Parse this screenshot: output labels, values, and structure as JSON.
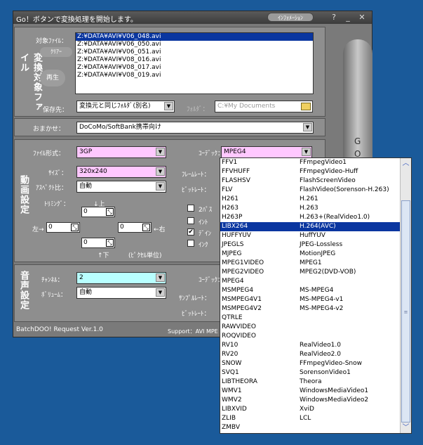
{
  "window": {
    "title": "Go！ボタンで変換処理を開始します。",
    "info_button": "ｲﾝﾌｫﾒｰｼｮﾝ",
    "help_icon": "?",
    "min_icon": "_",
    "close_icon": "✕"
  },
  "source": {
    "section_title": "変換対象ファイル",
    "files_label": "対象ﾌｧｲﾙ：",
    "clear_button": "ｸﾘｱｰ",
    "play_button": "再生",
    "files": [
      "Z:¥DATA¥AVI¥V06_048.avi",
      "Z:¥DATA¥AVI¥V06_050.avi",
      "Z:¥DATA¥AVI¥V06_051.avi",
      "Z:¥DATA¥AVI¥V08_016.avi",
      "Z:¥DATA¥AVI¥V08_017.avi",
      "Z:¥DATA¥AVI¥V08_019.avi"
    ],
    "save_label": "保存先：",
    "save_value": "変換元と同じﾌｫﾙﾀﾞ(別名)",
    "folder_label": "ﾌｫﾙﾀﾞ：",
    "folder_value": "C:¥My Documents"
  },
  "preset": {
    "label": "おまかせ：",
    "value": "DoCoMo/SoftBank携帯向け"
  },
  "video": {
    "section_title": "動画設定",
    "format_label": "ﾌｧｲﾙ形式：",
    "format_value": "3GP",
    "size_label": "ｻｲｽﾞ：",
    "size_value": "320x240",
    "aspect_label": "ｱｽﾍﾟｸﾄ比：",
    "aspect_value": "自動",
    "trim_label": "ﾄﾘﾐﾝｸﾞ：",
    "trim_top_label": "↓上",
    "trim_left_label": "左→",
    "trim_right_label": "←右",
    "trim_bottom_label": "↑下",
    "trim_top": "0",
    "trim_left": "0",
    "trim_right": "0",
    "trim_bottom": "0",
    "pixel_unit": "(ﾋﾟｸｾﾙ単位)",
    "codec_label": "ｺｰﾃﾞｯｸ：",
    "codec_value": "MPEG4",
    "framerate_label": "ﾌﾚｰﾑﾚｰﾄ：",
    "bitrate_label": "ﾋﾞｯﾄﾚｰﾄ：",
    "opt1": "2ﾊﾟｽ",
    "opt2": "ｲﾝﾄ",
    "opt3": "ﾃﾞｲﾝ",
    "opt4": "ｲﾝｸ"
  },
  "audio": {
    "section_title": "音声設定",
    "channel_label": "ﾁｬﾝﾈﾙ：",
    "channel_value": "2",
    "volume_label": "ﾎﾞﾘｭｰﾑ：",
    "volume_value": "自動",
    "codec_label": "ｺｰﾃﾞｯｸ：",
    "samplerate_label": "ｻﾝﾌﾟﾙﾚｰﾄ：",
    "bitrate_label": "ﾋﾞｯﾄﾚｰﾄ："
  },
  "footer": {
    "version": "BatchDOO! Request Ver.1.0",
    "support": "Support：AVI MPE"
  },
  "go_button": {
    "label1": "G",
    "label2": "O"
  },
  "codec_dropdown": {
    "highlighted_index": 7,
    "items": [
      [
        "FFV1",
        "FFmpegVideo1"
      ],
      [
        "FFVHUFF",
        "FFmpegVideo-Huff"
      ],
      [
        "FLASHSV",
        "FlashScreenVideo"
      ],
      [
        "FLV",
        "FlashVideo(Sorenson-H.263)"
      ],
      [
        "H261",
        "H.261"
      ],
      [
        "H263",
        "H.263"
      ],
      [
        "H263P",
        "H.263+(RealVideo1.0)"
      ],
      [
        "LIBX264",
        "H.264(AVC)"
      ],
      [
        "HUFFYUV",
        "HuffYUV"
      ],
      [
        "JPEGLS",
        "JPEG-Lossless"
      ],
      [
        "MJPEG",
        "MotionJPEG"
      ],
      [
        "MPEG1VIDEO",
        "MPEG1"
      ],
      [
        "MPEG2VIDEO",
        "MPEG2(DVD-VOB)"
      ],
      [
        "MPEG4",
        ""
      ],
      [
        "MSMPEG4",
        "MS-MPEG4"
      ],
      [
        "MSMPEG4V1",
        "MS-MPEG4-v1"
      ],
      [
        "MSMPEG4V2",
        "MS-MPEG4-v2"
      ],
      [
        "QTRLE",
        ""
      ],
      [
        "RAWVIDEO",
        ""
      ],
      [
        "ROQVIDEO",
        ""
      ],
      [
        "RV10",
        "RealVideo1.0"
      ],
      [
        "RV20",
        "RealVideo2.0"
      ],
      [
        "SNOW",
        "FFmpegVideo-Snow"
      ],
      [
        "SVQ1",
        "SorensonVideo1"
      ],
      [
        "LIBTHEORA",
        "Theora"
      ],
      [
        "WMV1",
        "WindowsMediaVideo1"
      ],
      [
        "WMV2",
        "WindowsMediaVideo2"
      ],
      [
        "LIBXVID",
        "XviD"
      ],
      [
        "ZLIB",
        "LCL"
      ],
      [
        "ZMBV",
        ""
      ]
    ]
  }
}
